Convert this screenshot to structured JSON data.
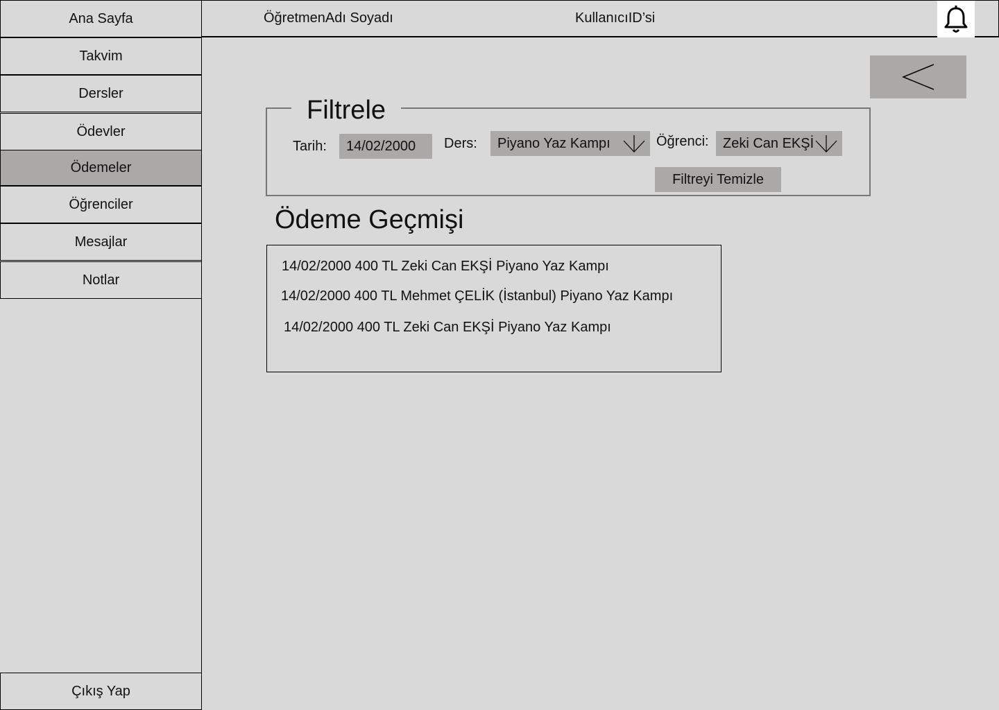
{
  "sidebar": {
    "home": "Ana Sayfa",
    "items": [
      {
        "label": "Takvim"
      },
      {
        "label": "Dersler"
      },
      {
        "label": "Ödevler"
      },
      {
        "label": "Ödemeler",
        "active": true
      },
      {
        "label": "Öğrenciler"
      },
      {
        "label": "Mesajlar"
      },
      {
        "label": "Notlar"
      }
    ],
    "logout": "Çıkış Yap"
  },
  "header": {
    "teacher_name": "ÖğretmenAdı Soyadı",
    "user_id": "KullanıcıID’si",
    "bell_icon": "bell-icon"
  },
  "back_icon": "chevron-left-icon",
  "filter": {
    "title": "Filtrele",
    "date_label": "Tarih:",
    "date_value": "14/02/2000",
    "course_label": "Ders:",
    "course_value": "Piyano Yaz Kampı",
    "student_label": "Öğrenci:",
    "student_value": "Zeki Can EKŞİ",
    "clear_label": "Filtreyi Temizle"
  },
  "history": {
    "title": "Ödeme Geçmişi",
    "rows": [
      "14/02/2000 400 TL Zeki Can EKŞİ Piyano Yaz Kampı",
      "14/02/2000 400 TL Mehmet ÇELİK (İstanbul) Piyano Yaz Kampı",
      "14/02/2000 400 TL Zeki Can EKŞİ Piyano Yaz Kampı"
    ]
  },
  "colors": {
    "background": "#d9d9d9",
    "active": "#aba8a8",
    "field": "#aba8a8"
  }
}
